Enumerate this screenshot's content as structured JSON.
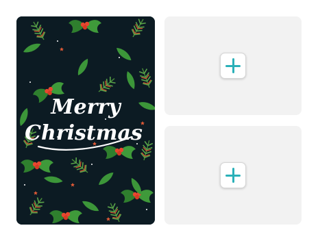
{
  "photo": {
    "greeting_line1": "Merry",
    "greeting_line2": "Christmas"
  },
  "slots": [
    {
      "icon": "plus-icon",
      "accent": "#2ab0b8"
    },
    {
      "icon": "plus-icon",
      "accent": "#2ab0b8"
    }
  ]
}
